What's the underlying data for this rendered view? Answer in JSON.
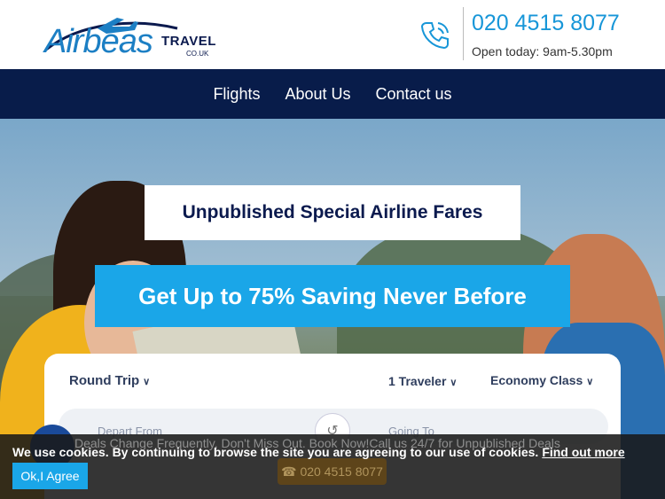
{
  "brand": {
    "logo_main": "Airbeas",
    "logo_travel": "TRAVEL",
    "logo_domain": "CO.UK"
  },
  "header": {
    "phone": "020 4515 8077",
    "hours": "Open today: 9am-5.30pm"
  },
  "nav": {
    "items": [
      {
        "label": "Flights"
      },
      {
        "label": "About Us"
      },
      {
        "label": "Contact us"
      }
    ]
  },
  "hero": {
    "tagline": "Unpublished Special Airline Fares",
    "headline": "Get Up to 75% Saving Never Before"
  },
  "search": {
    "trip_type": "Round Trip",
    "travelers": "1 Traveler",
    "cabin": "Economy Class",
    "from_placeholder": "Depart From",
    "to_placeholder": "Going To"
  },
  "promo": {
    "text": "Deals Change Frequently, Don't Miss Out. Book Now!Call us 24/7 for Unpublished Deals",
    "call_label": "020 4515 8077"
  },
  "cookie": {
    "message": "We use cookies. By continuing to browse the site you are agreeing to our use of cookies.",
    "link": "Find out more",
    "button": "Ok,I Agree"
  },
  "colors": {
    "navy": "#081c4a",
    "accent": "#1aa6e8",
    "phone": "#1796d8"
  }
}
